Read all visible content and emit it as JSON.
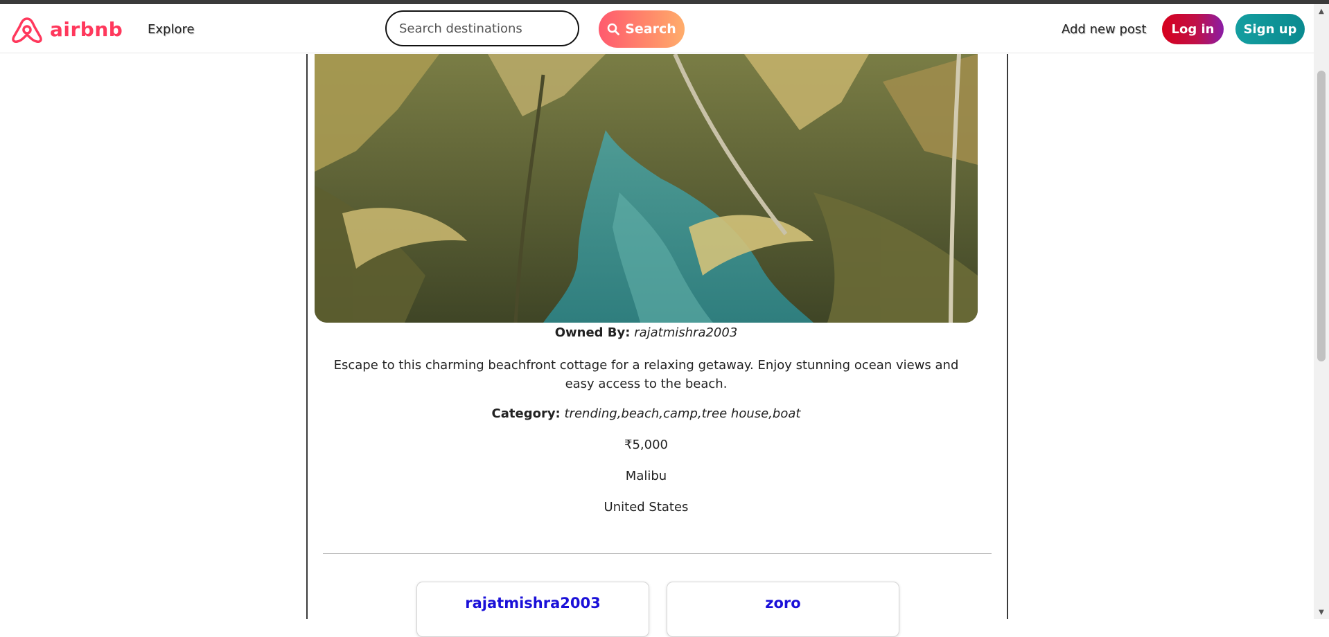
{
  "colors": {
    "brand": "#ff385c",
    "login_gradient": [
      "#d7001c",
      "#8a1da6"
    ],
    "signup_gradient": [
      "#149ea0",
      "#0a8a8f"
    ],
    "search_gradient": [
      "#ff5a6e",
      "#ffad6b"
    ],
    "review_author": "#1a10d8"
  },
  "navbar": {
    "brand_icon": "airbnb-logo-icon",
    "brand_text": "airbnb",
    "explore_label": "Explore",
    "search_placeholder": "Search destinations",
    "search_icon": "magnifier-icon",
    "search_button_label": "Search",
    "add_post_label": "Add new post",
    "login_label": "Log in",
    "signup_label": "Sign up"
  },
  "listing": {
    "image_subject": "listing-photo",
    "owned_label": "Owned By:",
    "owner": "rajatmishra2003",
    "description": "Escape to this charming beachfront cottage for a relaxing getaway. Enjoy stunning ocean views and easy access to the beach.",
    "category_label": "Category:",
    "categories": "trending,beach,camp,tree house,boat",
    "price": "₹5,000",
    "location": "Malibu",
    "country": "United States"
  },
  "reviews": [
    {
      "author": "rajatmishra2003"
    },
    {
      "author": "zoro"
    }
  ],
  "scrollbar": {
    "up_icon": "scroll-up-arrow-icon",
    "down_icon": "scroll-down-arrow-icon"
  }
}
